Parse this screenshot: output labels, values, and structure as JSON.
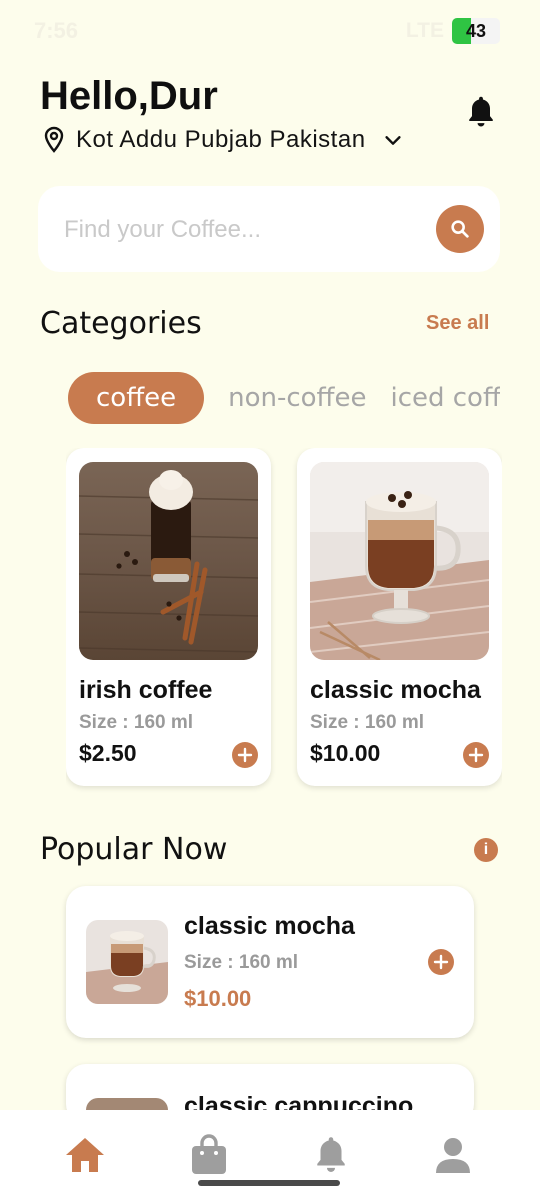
{
  "status_bar": {
    "time": "7:56",
    "network": "LTE",
    "battery": "43"
  },
  "header": {
    "greeting": "Hello,Dur",
    "location": "Kot Addu Pubjab Pakistan"
  },
  "search": {
    "placeholder": "Find your Coffee..."
  },
  "categories": {
    "title": "Categories",
    "see_all": "See all",
    "chips": [
      "coffee",
      "non-coffee",
      "iced coffee"
    ],
    "selected": "coffee"
  },
  "products": [
    {
      "name": "irish coffee",
      "size": "Size : 160 ml",
      "price": "$2.50"
    },
    {
      "name": "classic mocha",
      "size": "Size : 160 ml",
      "price": "$10.00"
    }
  ],
  "popular": {
    "title": "Popular Now",
    "items": [
      {
        "name": "classic mocha",
        "size": "Size : 160 ml",
        "price": "$10.00"
      },
      {
        "name": "classic cappuccino"
      }
    ]
  },
  "nav": [
    "home-icon",
    "bag-icon",
    "bell-icon",
    "profile-icon"
  ],
  "colors": {
    "accent": "#c87b4f",
    "background": "#fdfdec"
  }
}
